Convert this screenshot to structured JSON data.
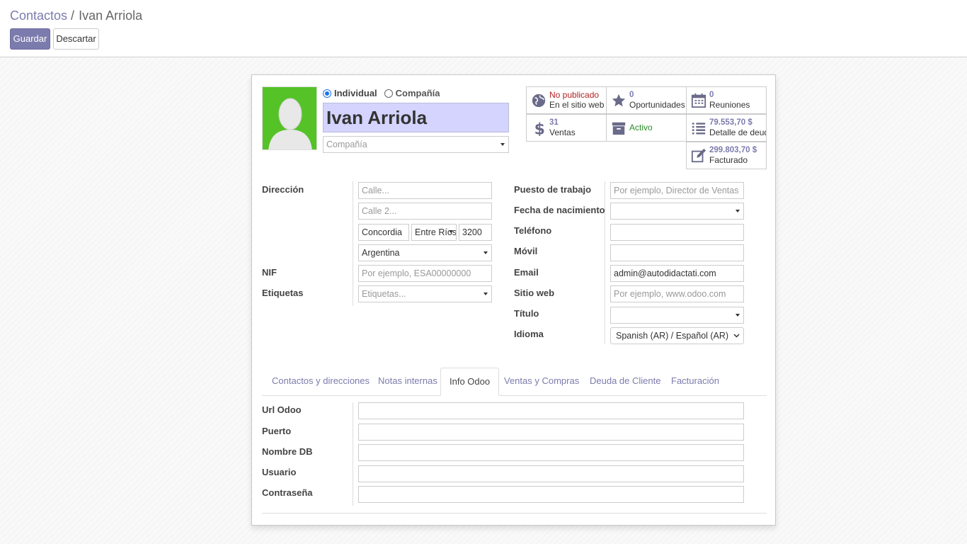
{
  "breadcrumb": {
    "parent": "Contactos",
    "separator": "/",
    "current": "Ivan Arriola"
  },
  "toolbar": {
    "save_label": "Guardar",
    "discard_label": "Descartar"
  },
  "header": {
    "type_options": [
      "Individual",
      "Compañía"
    ],
    "selected_type": "Individual",
    "name": "Ivan Arriola",
    "company_placeholder": "Compañía"
  },
  "smart_buttons": {
    "website": {
      "value": "No publicado",
      "label": "En el sitio web",
      "icon": "globe-icon"
    },
    "opportunities": {
      "value": "0",
      "label": "Oportunidades",
      "icon": "star-icon"
    },
    "meetings": {
      "value": "0",
      "label": "Reuniones",
      "icon": "calendar-icon"
    },
    "sales": {
      "value": "31",
      "label": "Ventas",
      "icon": "dollar-icon"
    },
    "active": {
      "label": "Activo",
      "icon": "archive-icon"
    },
    "debt": {
      "value": "79.553,70 $",
      "label": "Detalle de deuda",
      "icon": "list-icon"
    },
    "invoiced": {
      "value": "299.803,70 $",
      "label": "Facturado",
      "icon": "edit-icon"
    }
  },
  "address": {
    "label": "Dirección",
    "street_placeholder": "Calle...",
    "street2_placeholder": "Calle 2...",
    "city": "Concordia",
    "state": "Entre Ríos",
    "zip": "3200",
    "country": "Argentina"
  },
  "nif": {
    "label": "NIF",
    "placeholder": "Por ejemplo, ESA00000000"
  },
  "tags": {
    "label": "Etiquetas",
    "placeholder": "Etiquetas..."
  },
  "right_fields": {
    "job": {
      "label": "Puesto de trabajo",
      "placeholder": "Por ejemplo, Director de Ventas"
    },
    "birthdate": {
      "label": "Fecha de nacimiento",
      "value": ""
    },
    "phone": {
      "label": "Teléfono",
      "value": ""
    },
    "mobile": {
      "label": "Móvil",
      "value": ""
    },
    "email": {
      "label": "Email",
      "value": "admin@autodidactati.com"
    },
    "website": {
      "label": "Sitio web",
      "placeholder": "Por ejemplo, www.odoo.com"
    },
    "title": {
      "label": "Título",
      "value": ""
    },
    "language": {
      "label": "Idioma",
      "value": "Spanish (AR) / Español (AR)"
    }
  },
  "tabs": [
    "Contactos y direcciones",
    "Notas internas",
    "Info Odoo",
    "Ventas y Compras",
    "Deuda de Cliente",
    "Facturación"
  ],
  "active_tab": "Info Odoo",
  "odoo_info": {
    "url_label": "Url Odoo",
    "port_label": "Puerto",
    "db_label": "Nombre DB",
    "user_label": "Usuario",
    "password_label": "Contraseña"
  },
  "colors": {
    "primary": "#7c7bad",
    "name_bg": "#d4d4ff",
    "avatar_bg": "#55c228"
  }
}
